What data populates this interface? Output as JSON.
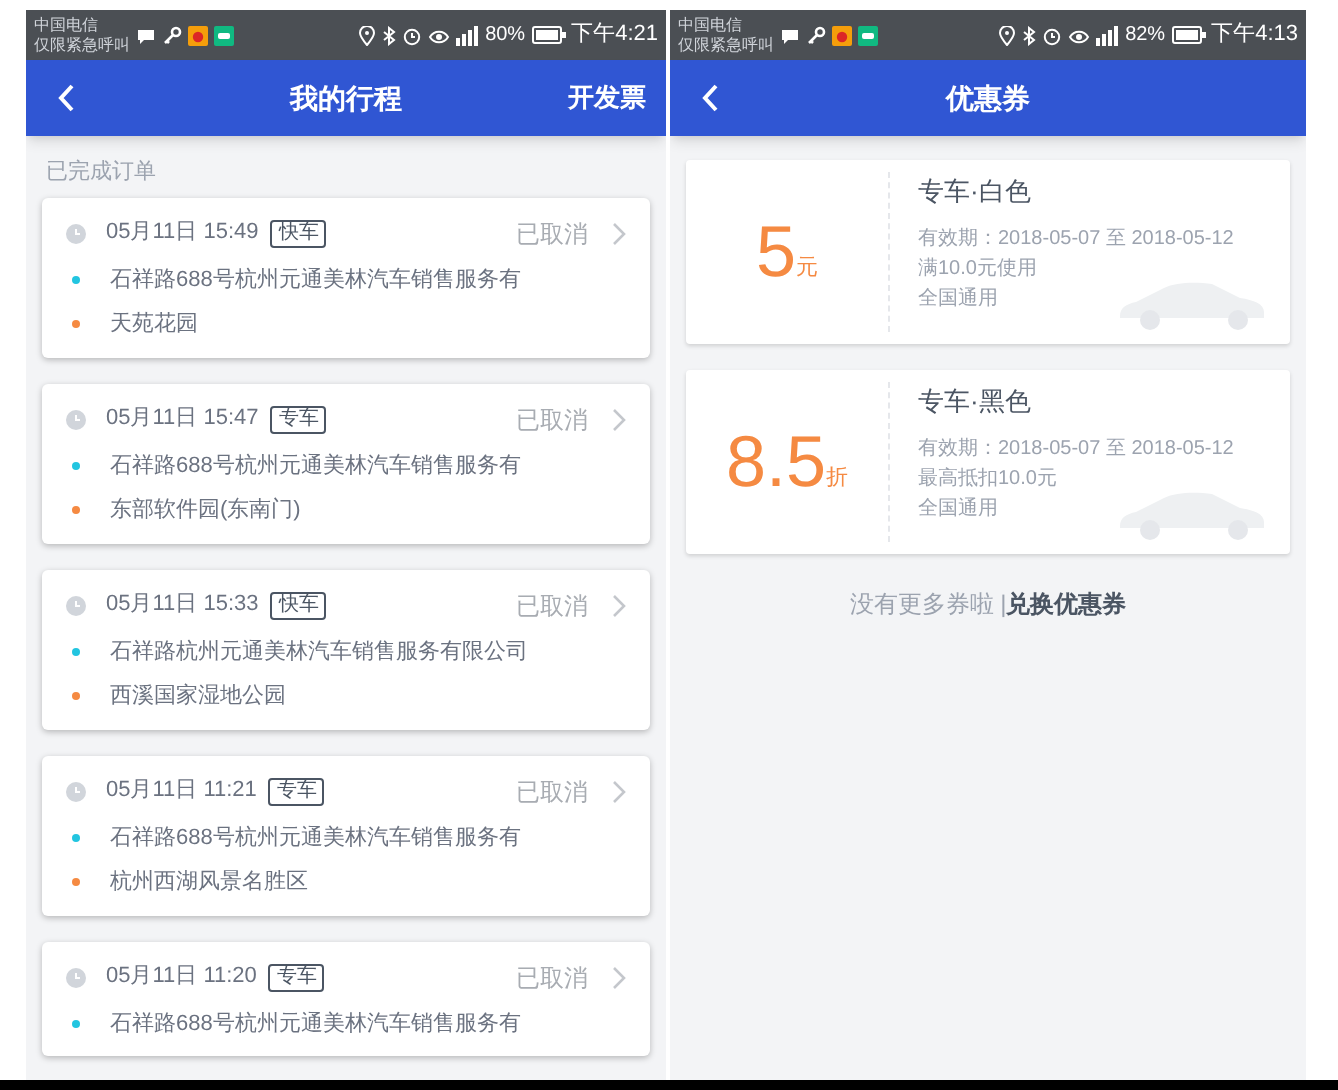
{
  "left_screen": {
    "status_bar": {
      "carrier": "中国电信",
      "carrier_note": "仅限紧急呼叫",
      "battery": "80%",
      "time": "下午4:21"
    },
    "header": {
      "title": "我的行程",
      "action": "开发票"
    },
    "section_label": "已完成订单",
    "orders": [
      {
        "time": "05月11日 15:49",
        "service": "快车",
        "status": "已取消",
        "pickup": "石祥路688号杭州元通美林汽车销售服务有",
        "dropoff": "天苑花园"
      },
      {
        "time": "05月11日 15:47",
        "service": "专车",
        "status": "已取消",
        "pickup": "石祥路688号杭州元通美林汽车销售服务有",
        "dropoff": "东部软件园(东南门)"
      },
      {
        "time": "05月11日 15:33",
        "service": "快车",
        "status": "已取消",
        "pickup": "石祥路杭州元通美林汽车销售服务有限公司",
        "dropoff": "西溪国家湿地公园"
      },
      {
        "time": "05月11日 11:21",
        "service": "专车",
        "status": "已取消",
        "pickup": "石祥路688号杭州元通美林汽车销售服务有",
        "dropoff": "杭州西湖风景名胜区"
      },
      {
        "time": "05月11日 11:20",
        "service": "专车",
        "status": "已取消",
        "pickup": "石祥路688号杭州元通美林汽车销售服务有"
      }
    ]
  },
  "right_screen": {
    "status_bar": {
      "carrier": "中国电信",
      "carrier_note": "仅限紧急呼叫",
      "battery": "82%",
      "time": "下午4:13"
    },
    "header": {
      "title": "优惠券"
    },
    "coupons": [
      {
        "amount": "5",
        "unit": "元",
        "name": "专车·白色",
        "validity": "有效期：2018-05-07 至 2018-05-12",
        "condition": "满10.0元使用",
        "scope": "全国通用"
      },
      {
        "amount": "8.5",
        "unit": "折",
        "name": "专车·黑色",
        "validity": "有效期：2018-05-07 至 2018-05-12",
        "condition": "最高抵扣10.0元",
        "scope": "全国通用"
      }
    ],
    "footer": {
      "note": "没有更多券啦 |",
      "link": "兑换优惠券"
    }
  }
}
